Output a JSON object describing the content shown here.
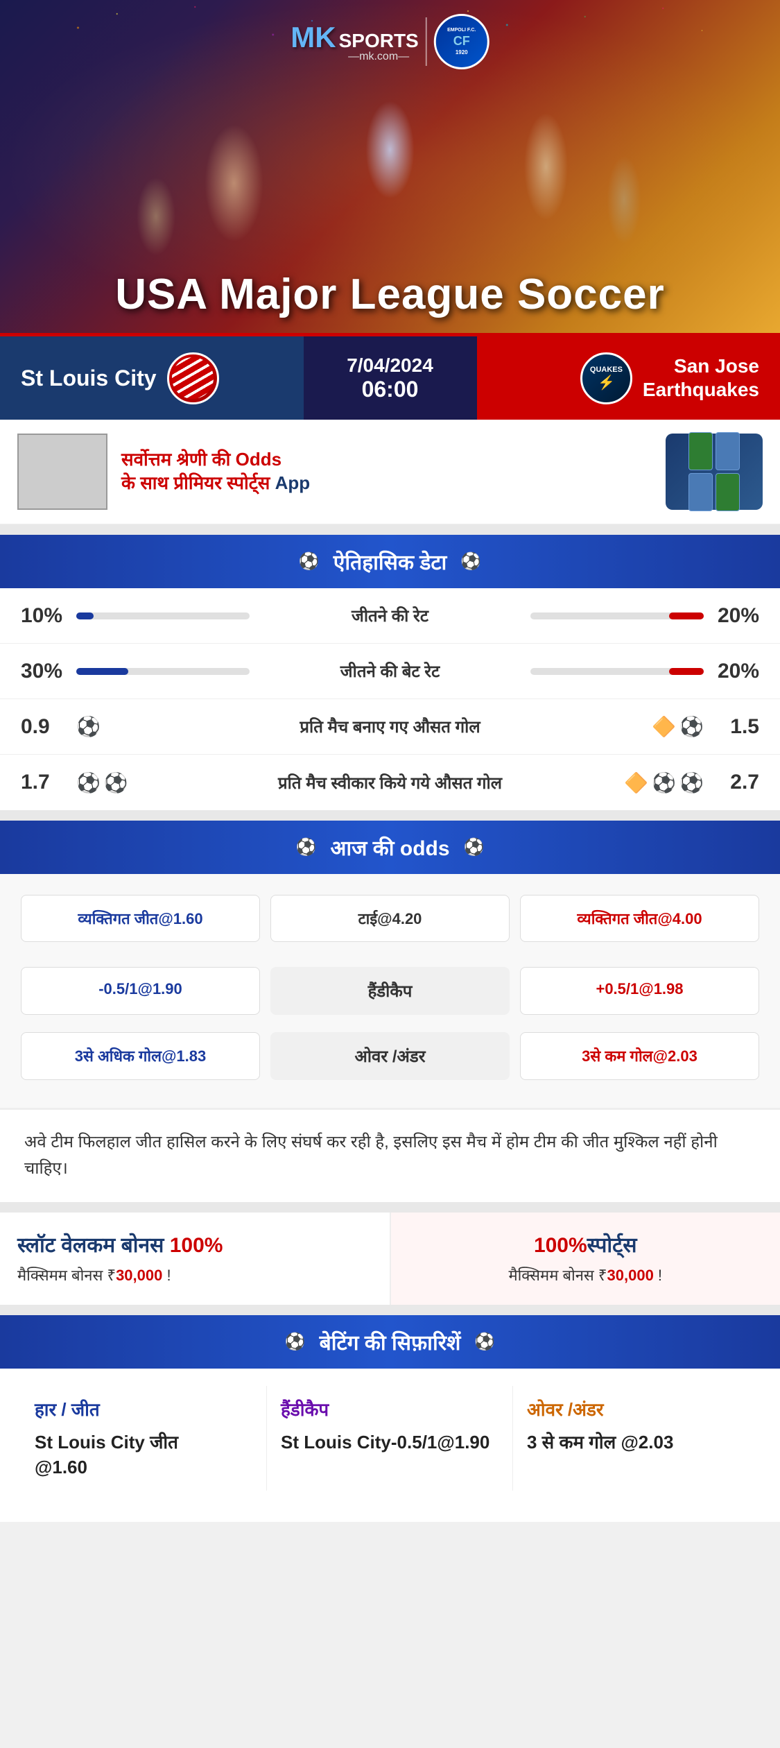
{
  "brand": {
    "mk": "MK",
    "sports": "SPORTS",
    "domain": "—mk.com—",
    "empoli_line1": "EMPOLI F.C.",
    "empoli_line2": "1920"
  },
  "hero": {
    "title": "USA Major League Soccer"
  },
  "match": {
    "date": "7/04/2024",
    "time": "06:00",
    "home_team": "St Louis City",
    "home_team_badge": "CITY",
    "away_team_line1": "San Jose",
    "away_team_line2": "Earthquakes",
    "away_team_badge": "QUAKES"
  },
  "promo": {
    "text_line1": "सर्वोत्तम श्रेणी की",
    "text_highlight": "Odds",
    "text_line2": "के साथ प्रीमियर स्पोर्ट्स",
    "text_app": "App"
  },
  "historical": {
    "section_title": "ऐतिहासिक डेटा",
    "rows": [
      {
        "label": "जीतने की रेट",
        "left_value": "10%",
        "right_value": "20%",
        "left_pct": 10,
        "right_pct": 20,
        "type": "bar"
      },
      {
        "label": "जीतने की बेट रेट",
        "left_value": "30%",
        "right_value": "20%",
        "left_pct": 30,
        "right_pct": 20,
        "type": "bar"
      },
      {
        "label": "प्रति मैच बनाए गए औसत गोल",
        "left_value": "0.9",
        "right_value": "1.5",
        "left_balls": 1,
        "right_balls": 2,
        "type": "balls"
      },
      {
        "label": "प्रति मैच स्वीकार किये गये औसत गोल",
        "left_value": "1.7",
        "right_value": "2.7",
        "left_balls": 2,
        "right_balls": 3,
        "type": "balls"
      }
    ]
  },
  "odds": {
    "section_title": "आज की odds",
    "rows": [
      {
        "label": "टाई@4.20",
        "left": "व्यक्तिगत जीत@1.60",
        "right": "व्यक्तिगत जीत@4.00",
        "left_color": "blue",
        "right_color": "red"
      },
      {
        "label": "हैंडीकैप",
        "left": "-0.5/1@1.90",
        "right": "+0.5/1@1.98",
        "left_color": "blue",
        "right_color": "red"
      },
      {
        "label": "ओवर /अंडर",
        "left": "3से अधिक गोल@1.83",
        "right": "3से कम गोल@2.03",
        "left_color": "blue",
        "right_color": "red"
      }
    ]
  },
  "analysis": {
    "text": "अवे टीम फिलहाल जीत हासिल करने के लिए संघर्ष कर रही है, इसलिए इस मैच में होम टीम की जीत मुश्किल नहीं होनी चाहिए।"
  },
  "bonus": {
    "card1_title_line1": "स्लॉट वेलकम बोनस",
    "card1_title_highlight": "100%",
    "card1_sub_prefix": "मैक्सिमम बोनस ₹",
    "card1_sub_amount": "30,000",
    "card1_sub_suffix": "  !",
    "card2_title_highlight": "100%",
    "card2_title_line1": "स्पोर्ट्स",
    "card2_sub_prefix": "मैक्सिमम बोनस  ₹",
    "card2_sub_amount": "30,000",
    "card2_sub_suffix": " !"
  },
  "recommendations": {
    "section_title": "बेटिंग की सिफ़ारिशें",
    "cols": [
      {
        "header": "हार / जीत",
        "header_color": "blue",
        "value_line1": "St Louis City जीत",
        "value_line2": "@1.60"
      },
      {
        "header": "हैंडीकैप",
        "header_color": "purple",
        "value": "St Louis City-0.5/1@1.90"
      },
      {
        "header": "ओवर /अंडर",
        "header_color": "orange",
        "value": "3 से कम गोल @2.03"
      }
    ]
  }
}
